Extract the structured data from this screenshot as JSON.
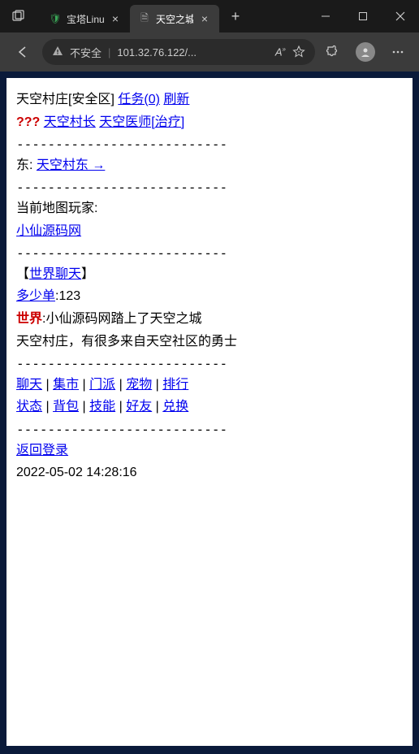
{
  "browser": {
    "tabs": [
      {
        "favicon": "🛡",
        "faviconColor": "#3aa757",
        "title": "宝塔Linux",
        "active": false
      },
      {
        "favicon": "🗎",
        "faviconColor": "#999",
        "title": "天空之城",
        "active": true
      }
    ],
    "url": {
      "securityLabel": "不安全",
      "address": "101.32.76.122/..."
    }
  },
  "page": {
    "location_title": "天空村庄[安全区]",
    "task_link": "任务(0)",
    "refresh_link": "刷新",
    "question_icon": "???",
    "npc1": "天空村长",
    "npc2": "天空医师[治疗]",
    "direction_label": "东:",
    "direction_link": "天空村东 →",
    "current_players_label": "当前地图玩家:",
    "player1": "小仙源码网",
    "world_chat_label": "世界聊天",
    "chat_prefix_link": "多少单",
    "chat_prefix_suffix": ":123",
    "world_label": "世界",
    "world_msg": ":小仙源码网踏上了天空之城",
    "village_desc": "天空村庄，有很多来自天空社区的勇士",
    "nav_links1": [
      "聊天",
      "集市",
      "门派",
      "宠物",
      "排行"
    ],
    "nav_links2": [
      "状态",
      "背包",
      "技能",
      "好友",
      "兑换"
    ],
    "return_login": "返回登录",
    "timestamp": "2022-05-02 14:28:16",
    "separator": "---------------------------"
  }
}
